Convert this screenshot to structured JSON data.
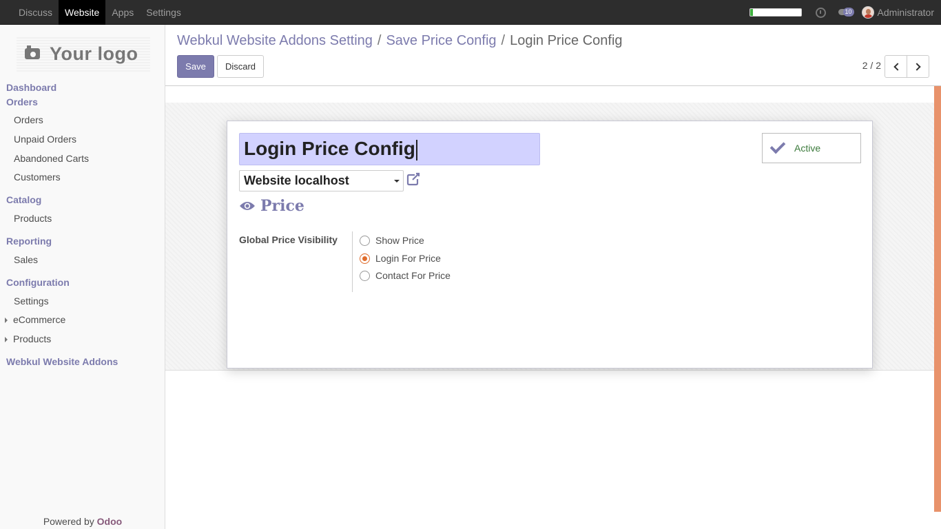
{
  "topbar": {
    "menu": [
      {
        "label": "Discuss",
        "active": false
      },
      {
        "label": "Website",
        "active": true
      },
      {
        "label": "Apps",
        "active": false
      },
      {
        "label": "Settings",
        "active": false
      }
    ],
    "progress_fraction": 0.06,
    "chat_badge": "10",
    "user_name": "Administrator"
  },
  "sidebar": {
    "logo_text": "Your logo",
    "dashboard": "Dashboard",
    "orders_heading": "Orders",
    "orders_items": [
      "Orders",
      "Unpaid Orders",
      "Abandoned Carts",
      "Customers"
    ],
    "catalog_heading": "Catalog",
    "catalog_items": [
      "Products"
    ],
    "reporting_heading": "Reporting",
    "reporting_items": [
      "Sales"
    ],
    "config_heading": "Configuration",
    "config_items": [
      "Settings"
    ],
    "config_collapsibles": [
      "eCommerce",
      "Products"
    ],
    "webkul_heading": "Webkul Website Addons",
    "powered_prefix": "Powered by",
    "powered_brand": "Odoo"
  },
  "control": {
    "breadcrumbs": [
      "Webkul Website Addons Setting",
      "Save Price Config"
    ],
    "breadcrumb_separator": "/",
    "breadcrumb_current": "Login Price Config",
    "save_label": "Save",
    "discard_label": "Discard",
    "pager": "2 / 2"
  },
  "form": {
    "name_value": "Login Price Config",
    "active_label": "Active",
    "website_value": "Website localhost",
    "section_title": "Price",
    "field_label": "Global Price Visibility",
    "options": [
      {
        "label": "Show Price",
        "checked": false
      },
      {
        "label": "Login For Price",
        "checked": true
      },
      {
        "label": "Contact For Price",
        "checked": false
      }
    ]
  },
  "colors": {
    "accent": "#7c7bad",
    "radio_checked": "#e06c2b",
    "active_text": "#3b7a3b",
    "scroll_accent": "#e8926b"
  }
}
